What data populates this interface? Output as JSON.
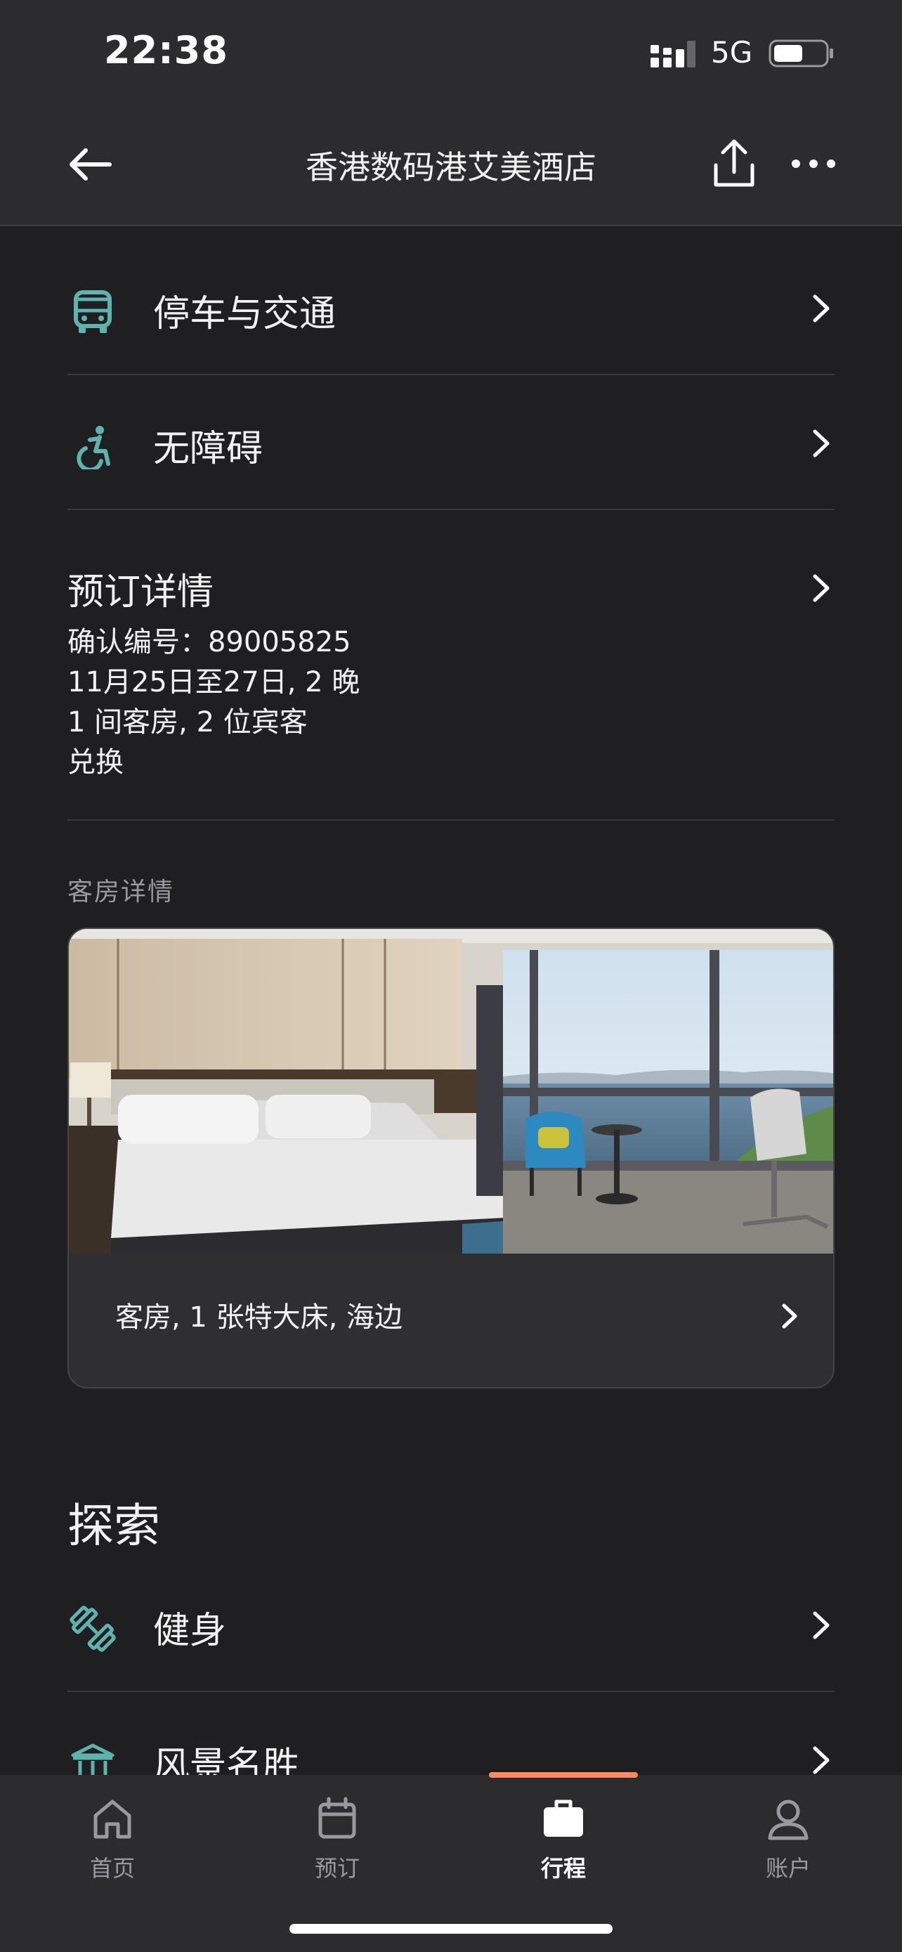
{
  "status_bar": {
    "time": "22:38",
    "network": "5G"
  },
  "nav": {
    "title": "香港数码港艾美酒店"
  },
  "menu": {
    "parking": "停车与交通",
    "accessibility": "无障碍"
  },
  "booking": {
    "title": "预订详情",
    "lines": [
      "确认编号：89005825",
      "11月25日至27日, 2 晚",
      "1 间客房, 2 位宾客",
      "兑换"
    ]
  },
  "room_section": {
    "caption": "客房详情",
    "room_label": "客房, 1 张特大床, 海边"
  },
  "explore": {
    "title": "探索",
    "fitness": "健身",
    "attractions": "风景名胜"
  },
  "tabs": [
    {
      "label": "首页",
      "icon": "home-icon"
    },
    {
      "label": "预订",
      "icon": "calendar-icon"
    },
    {
      "label": "行程",
      "icon": "briefcase-icon"
    },
    {
      "label": "账户",
      "icon": "person-icon"
    }
  ],
  "colors": {
    "background": "#1f1f21",
    "bar": "#2c2c2e",
    "accent_teal": "#5fb3ae",
    "tab_indicator": "#ff8a65"
  }
}
